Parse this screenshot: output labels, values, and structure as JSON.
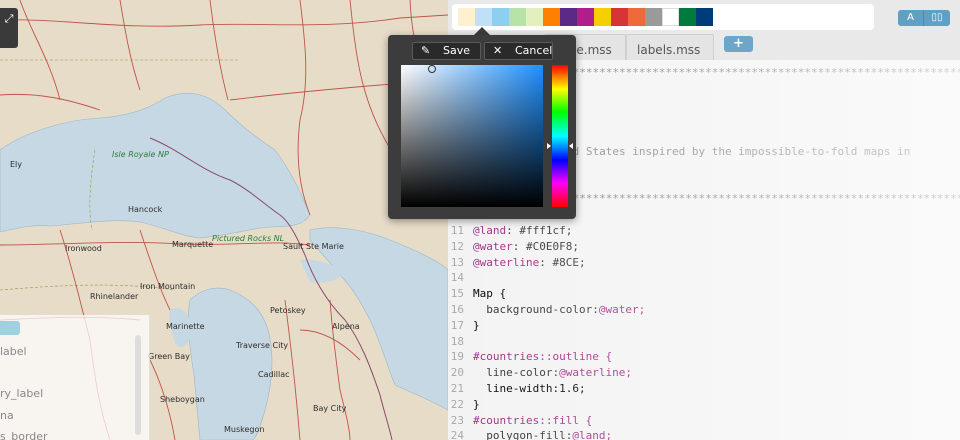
{
  "map": {
    "cities": [
      {
        "name": "Ely"
      },
      {
        "name": "Hancock"
      },
      {
        "name": "Ironwood"
      },
      {
        "name": "Marquette"
      },
      {
        "name": "Sault Ste Marie"
      },
      {
        "name": "Rhinelander"
      },
      {
        "name": "Iron Mountain"
      },
      {
        "name": "Marinette"
      },
      {
        "name": "Green Bay"
      },
      {
        "name": "Petoskey"
      },
      {
        "name": "Alpena"
      },
      {
        "name": "Traverse City"
      },
      {
        "name": "Cadillac"
      },
      {
        "name": "Sheboygan"
      },
      {
        "name": "Bay City"
      },
      {
        "name": "Muskegon"
      }
    ],
    "parks": [
      {
        "name": "Isle Royale NP"
      },
      {
        "name": "Pictured Rocks NL"
      }
    ],
    "fullscreen_icon": "expand-icon",
    "layer_panel_items": [
      "label",
      "ry_label",
      "na",
      "s_border"
    ],
    "colors": {
      "water": "#C0E0F8",
      "land": "#fff1cf",
      "road": "#c0544a",
      "border": "#8a4a6a"
    }
  },
  "editor": {
    "palette": [
      "#fff1cf",
      "#c0e0f8",
      "#8ccfee",
      "#b7e2a8",
      "#e4efc0",
      "#ff7f00",
      "#5b2a86",
      "#b01e8c",
      "#f5d000",
      "#d7343a",
      "#ef6a3a",
      "#9a9a9a",
      "#ffffff",
      "#007a3d",
      "#003b7a"
    ],
    "tools": [
      {
        "icon": "font-icon",
        "glyph": "A"
      },
      {
        "icon": "book-icon",
        "glyph": "▯▯"
      }
    ],
    "tabs": [
      {
        "label": "style.mss"
      },
      {
        "label": "labels.mss"
      }
    ],
    "add_tab_label": "+",
    "code_lines": [
      {
        "n": "",
        "text": "/***************************************************************"
      },
      {
        "n": "",
        "text": ""
      },
      {
        "n": "",
        "text": ""
      },
      {
        "n": "",
        "text": ""
      },
      {
        "n": "",
        "text": ""
      },
      {
        "n": "",
        "text": "ed States inspired by the impossible-to-fold maps in"
      },
      {
        "n": "",
        "text": ""
      },
      {
        "n": "",
        "text": ""
      },
      {
        "n": "",
        "text": "***************************************************************/"
      },
      {
        "n": "",
        "text": ""
      },
      {
        "n": "11",
        "var": "@land",
        "rest": ": #fff1cf;"
      },
      {
        "n": "12",
        "var": "@water",
        "rest": ": #C0E0F8;"
      },
      {
        "n": "13",
        "var": "@waterline",
        "rest": ": #8CE;"
      },
      {
        "n": "14",
        "text": ""
      },
      {
        "n": "15",
        "text": "Map {"
      },
      {
        "n": "16",
        "text": "  background-color:@water;"
      },
      {
        "n": "17",
        "text": "}"
      },
      {
        "n": "18",
        "text": ""
      },
      {
        "n": "19",
        "text": "#countries::outline {"
      },
      {
        "n": "20",
        "text": "  line-color:@waterline;"
      },
      {
        "n": "21",
        "text": "  line-width:1.6;"
      },
      {
        "n": "22",
        "text": "}"
      },
      {
        "n": "23",
        "text": "#countries::fill {"
      },
      {
        "n": "24",
        "text": "  polygon-fill:@land;"
      }
    ]
  },
  "picker": {
    "save_label": "Save",
    "cancel_label": "Cancel",
    "save_icon": "pencil-icon",
    "cancel_icon": "x-icon"
  }
}
